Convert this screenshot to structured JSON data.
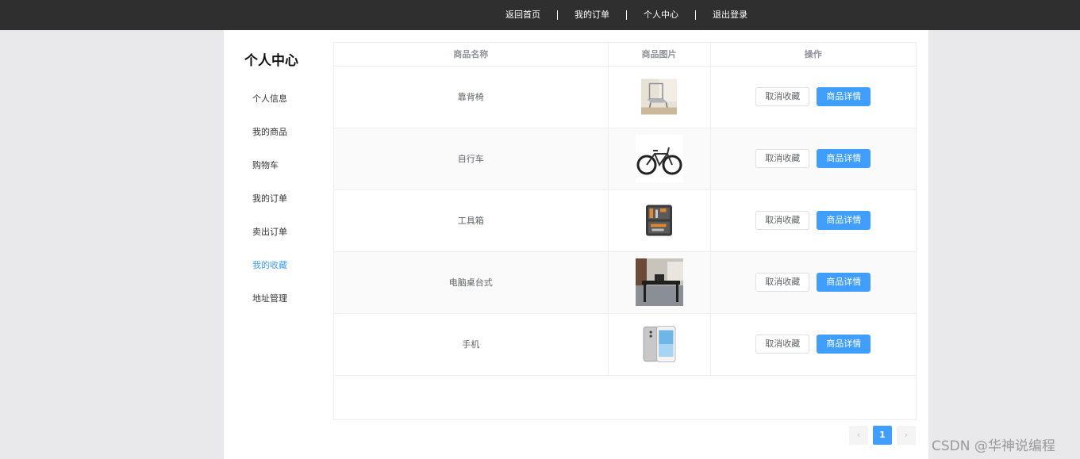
{
  "topnav": {
    "home": "返回首页",
    "orders": "我的订单",
    "profile": "个人中心",
    "logout": "退出登录"
  },
  "sidebar": {
    "title": "个人中心",
    "items": [
      {
        "label": "个人信息"
      },
      {
        "label": "我的商品"
      },
      {
        "label": "购物车"
      },
      {
        "label": "我的订单"
      },
      {
        "label": "卖出订单"
      },
      {
        "label": "我的收藏",
        "active": true
      },
      {
        "label": "地址管理"
      }
    ]
  },
  "table": {
    "headers": {
      "name": "商品名称",
      "image": "商品图片",
      "action": "操作"
    },
    "rows": [
      {
        "name": "靠背椅",
        "image_icon": "chair-photo"
      },
      {
        "name": "自行车",
        "image_icon": "bicycle-photo"
      },
      {
        "name": "工具箱",
        "image_icon": "toolbox-photo"
      },
      {
        "name": "电脑桌台式",
        "image_icon": "desk-photo"
      },
      {
        "name": "手机",
        "image_icon": "phone-photo"
      }
    ],
    "cancel_label": "取消收藏",
    "detail_label": "商品详情"
  },
  "pager": {
    "prev": "‹",
    "current": "1",
    "next": "›"
  },
  "watermark": "CSDN @华神说编程",
  "colors": {
    "accent": "#409eff",
    "topbar": "#2f2f2f"
  }
}
